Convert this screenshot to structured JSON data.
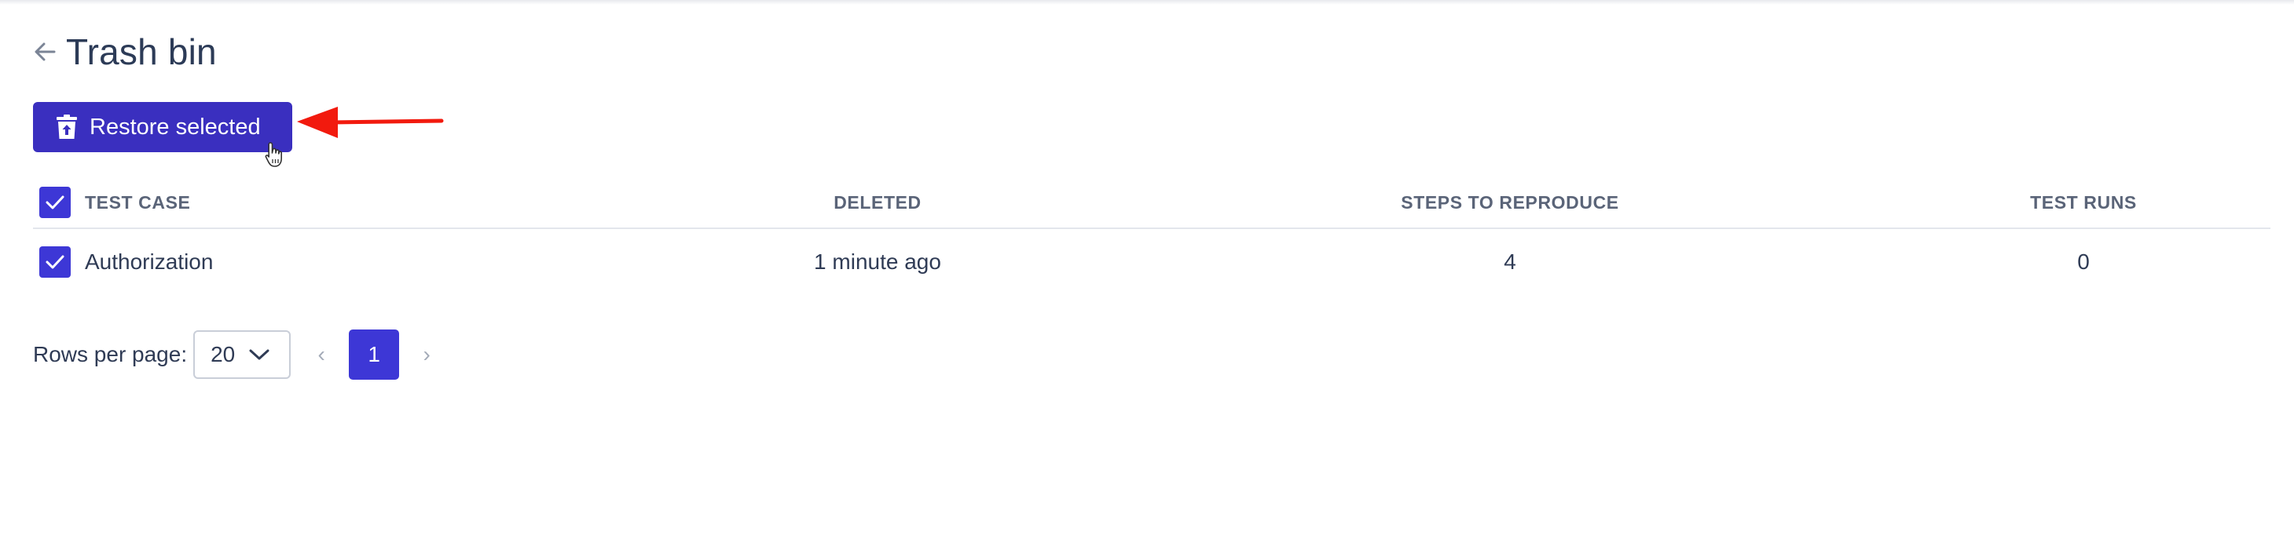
{
  "header": {
    "back_icon": "arrow-left-icon",
    "title": "Trash bin"
  },
  "toolbar": {
    "restore_label": "Restore selected",
    "restore_icon": "trash-restore-icon"
  },
  "annotation": {
    "arrow_color": "#f21a0e",
    "cursor_icon": "hand-pointer-icon"
  },
  "table": {
    "columns": [
      "TEST CASE",
      "DELETED",
      "STEPS TO REPRODUCE",
      "TEST RUNS"
    ],
    "select_all_checked": true,
    "rows": [
      {
        "checked": true,
        "name": "Authorization",
        "deleted": "1 minute ago",
        "steps": "4",
        "runs": "0"
      }
    ]
  },
  "pagination": {
    "rows_label": "Rows per page:",
    "rows_per_page": "20",
    "prev": "‹",
    "current_page": "1",
    "next": "›"
  },
  "colors": {
    "accent": "#3d37d6",
    "button": "#3a2fbf",
    "text": "#2f3b55",
    "header_text": "#5a6478"
  }
}
